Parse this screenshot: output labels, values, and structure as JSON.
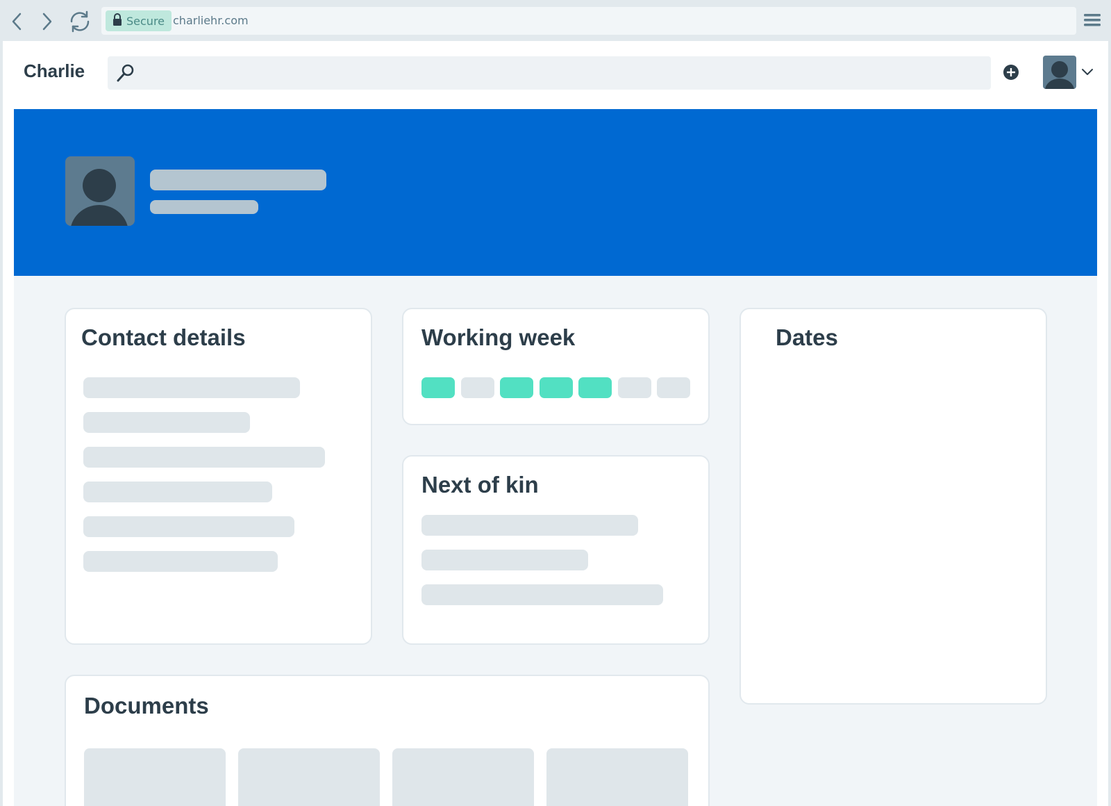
{
  "browser": {
    "secure_label": "Secure",
    "url": "charliehr.com",
    "icons": [
      "back-arrow-icon",
      "forward-arrow-icon",
      "reload-icon",
      "lock-icon",
      "hamburger-menu-icon"
    ]
  },
  "app": {
    "brand": "Charlie",
    "search": {
      "placeholder": "",
      "icon": "search-icon"
    },
    "header_icons": [
      "add-circle-icon",
      "user-avatar",
      "chevron-down-icon"
    ]
  },
  "colors": {
    "hero": "#0069d2",
    "accent_day": "#52e0c2",
    "skeleton": "#dfe6ea",
    "text": "#2d3e4a"
  },
  "cards": {
    "contact": {
      "title": "Contact details"
    },
    "working_week": {
      "title": "Working week",
      "days": [
        true,
        false,
        true,
        true,
        true,
        false,
        false
      ]
    },
    "next_of_kin": {
      "title": "Next of kin"
    },
    "dates": {
      "title": "Dates"
    },
    "documents": {
      "title": "Documents"
    }
  }
}
